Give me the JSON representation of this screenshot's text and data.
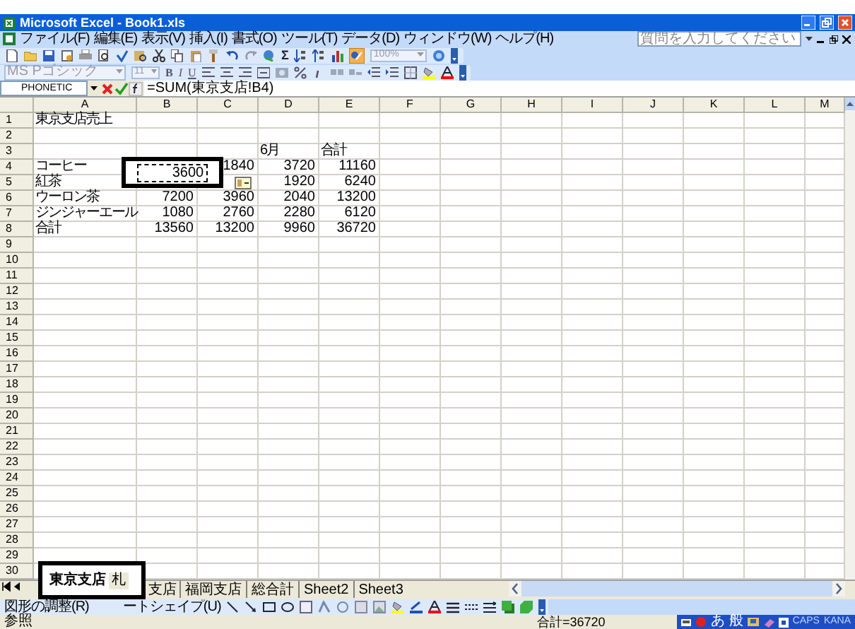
{
  "window": {
    "title": "Microsoft Excel - Book1.xls"
  },
  "menu": [
    "ファイル(F)",
    "編集(E)",
    "表示(V)",
    "挿入(I)",
    "書式(O)",
    "ツール(T)",
    "データ(D)",
    "ウィンドウ(W)",
    "ヘルプ(H)"
  ],
  "help_box": {
    "placeholder": "質問を入力してください"
  },
  "standard_toolbar": {
    "sum": "Σ",
    "zoom": "100%"
  },
  "format_toolbar": {
    "font": "MS Pゴシック",
    "size": "11",
    "styles": [
      "B",
      "I",
      "U"
    ]
  },
  "formula_bar": {
    "name_box": "PHONETIC",
    "formula": "=SUM(東京支店!B4)"
  },
  "sheet": {
    "columns": [
      "A",
      "B",
      "C",
      "D",
      "E",
      "F",
      "G",
      "H",
      "I",
      "J",
      "K",
      "L",
      "M"
    ],
    "marquee_cell": "3600",
    "rows": [
      {
        "number": "1",
        "cells": [
          {
            "text": "東京支店売上",
            "kind": "text"
          }
        ]
      },
      {
        "number": "2",
        "cells": []
      },
      {
        "number": "3",
        "cells": [
          {
            "kind": "empty"
          },
          {
            "kind": "empty"
          },
          {
            "kind": "empty"
          },
          {
            "text": "6月",
            "kind": "text"
          },
          {
            "text": "合計",
            "kind": "text"
          }
        ]
      },
      {
        "number": "4",
        "cells": [
          {
            "text": "コーヒー",
            "kind": "text"
          },
          {
            "kind": "hidden"
          },
          {
            "text": "1840",
            "kind": "number"
          },
          {
            "text": "3720",
            "kind": "number"
          },
          {
            "text": "11160",
            "kind": "number"
          }
        ]
      },
      {
        "number": "5",
        "cells": [
          {
            "text": "紅茶",
            "kind": "text"
          },
          {
            "kind": "empty"
          },
          {
            "kind": "smart-tag"
          },
          {
            "text": "1920",
            "kind": "number"
          },
          {
            "text": "6240",
            "kind": "number"
          }
        ]
      },
      {
        "number": "6",
        "cells": [
          {
            "text": "ウーロン茶",
            "kind": "text"
          },
          {
            "text": "7200",
            "kind": "number"
          },
          {
            "text": "3960",
            "kind": "number"
          },
          {
            "text": "2040",
            "kind": "number"
          },
          {
            "text": "13200",
            "kind": "number"
          }
        ]
      },
      {
        "number": "7",
        "cells": [
          {
            "text": "ジンジャーエール",
            "kind": "text"
          },
          {
            "text": "1080",
            "kind": "number"
          },
          {
            "text": "2760",
            "kind": "number"
          },
          {
            "text": "2280",
            "kind": "number"
          },
          {
            "text": "6120",
            "kind": "number"
          }
        ]
      },
      {
        "number": "8",
        "cells": [
          {
            "text": "合計",
            "kind": "text"
          },
          {
            "text": "13560",
            "kind": "number"
          },
          {
            "text": "13200",
            "kind": "number"
          },
          {
            "text": "9960",
            "kind": "number"
          },
          {
            "text": "36720",
            "kind": "number"
          }
        ]
      },
      {
        "number": "9",
        "cells": []
      },
      {
        "number": "10",
        "cells": []
      },
      {
        "number": "11",
        "cells": []
      },
      {
        "number": "12",
        "cells": []
      },
      {
        "number": "13",
        "cells": []
      },
      {
        "number": "14",
        "cells": []
      },
      {
        "number": "15",
        "cells": []
      },
      {
        "number": "16",
        "cells": []
      },
      {
        "number": "17",
        "cells": []
      },
      {
        "number": "18",
        "cells": []
      },
      {
        "number": "19",
        "cells": []
      },
      {
        "number": "20",
        "cells": []
      },
      {
        "number": "21",
        "cells": []
      },
      {
        "number": "22",
        "cells": []
      },
      {
        "number": "23",
        "cells": []
      },
      {
        "number": "24",
        "cells": []
      },
      {
        "number": "25",
        "cells": []
      },
      {
        "number": "26",
        "cells": []
      },
      {
        "number": "27",
        "cells": []
      },
      {
        "number": "28",
        "cells": []
      },
      {
        "number": "29",
        "cells": []
      },
      {
        "number": "30",
        "cells": []
      }
    ]
  },
  "tabs": [
    {
      "label": "東京支店",
      "selected": true
    },
    {
      "label_start": "札",
      "label_end": "支店",
      "selected": false
    },
    {
      "label": "福岡支店",
      "selected": false
    },
    {
      "label": "総合計",
      "selected": false
    },
    {
      "label": "Sheet2",
      "selected": false
    },
    {
      "label": "Sheet3",
      "selected": false
    }
  ],
  "drawing_toolbar": {
    "draw_menu": "図形の調整(R)",
    "autoshape_menu": "ートシェイプ(U)"
  },
  "status_bar": {
    "mode": "参照",
    "sum": "合計=36720"
  },
  "language_bar": {
    "input_mode": "あ",
    "dictionary": "般",
    "caps": "CAPS",
    "kana": "KANA"
  }
}
